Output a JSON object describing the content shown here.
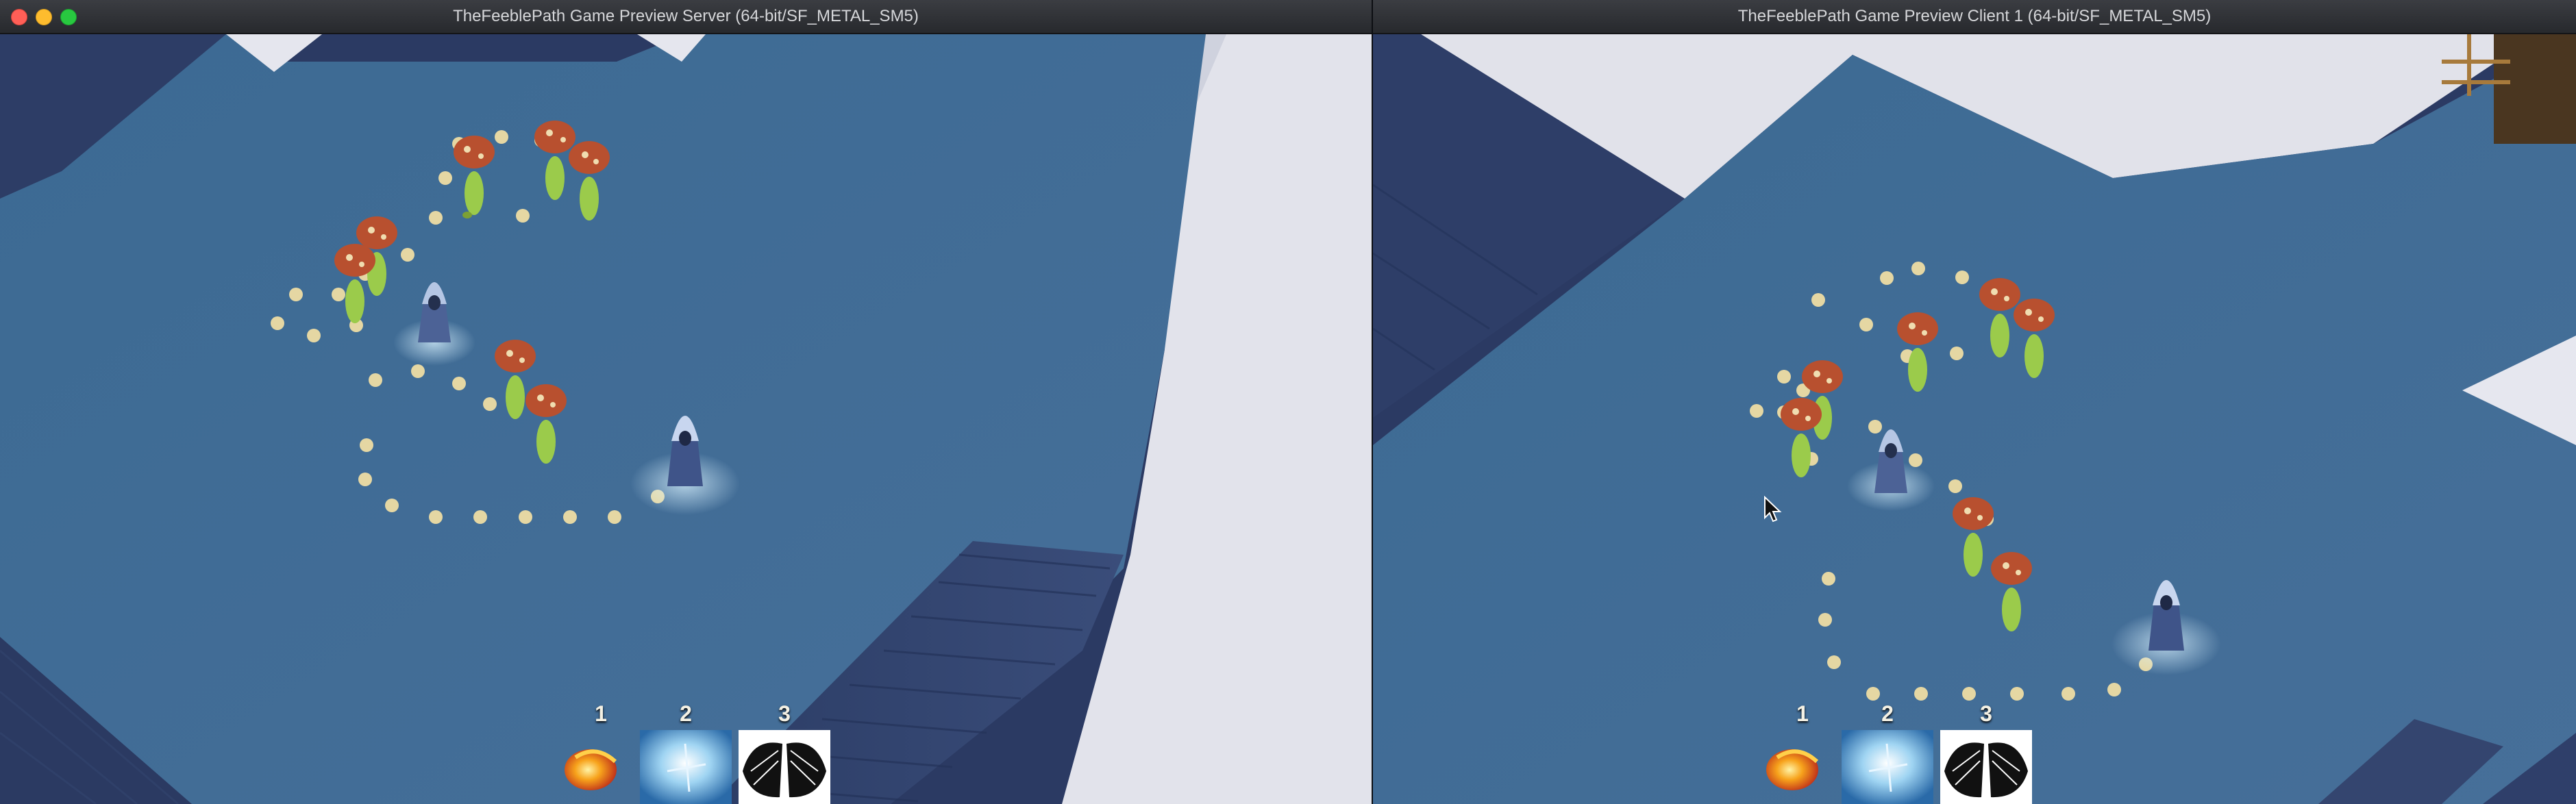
{
  "windows": [
    {
      "title": "TheFeeblePath Game Preview Server (64-bit/SF_METAL_SM5)",
      "abilities": [
        {
          "key": "1",
          "icon": "fireball-icon"
        },
        {
          "key": "2",
          "icon": "frost-icon"
        },
        {
          "key": "3",
          "icon": "wings-icon"
        }
      ]
    },
    {
      "title": "TheFeeblePath Game Preview Client 1 (64-bit/SF_METAL_SM5)",
      "abilities": [
        {
          "key": "1",
          "icon": "fireball-icon"
        },
        {
          "key": "2",
          "icon": "frost-icon"
        },
        {
          "key": "3",
          "icon": "wings-icon"
        }
      ]
    }
  ],
  "colors": {
    "floor": "#3f6e98",
    "wall_dark": "#2a3a63",
    "wall_light": "#e3e4ec",
    "path_dot": "#e5d7a3",
    "mushroom_cap": "#b8502f"
  }
}
